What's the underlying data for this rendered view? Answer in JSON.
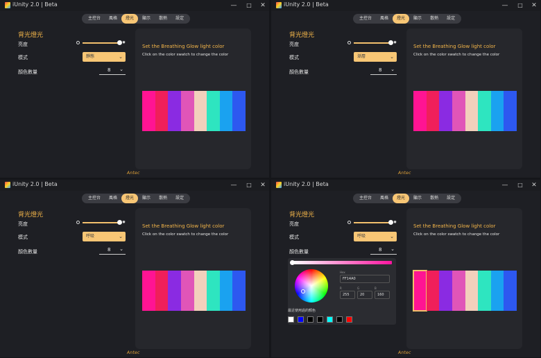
{
  "app": {
    "title": "iUnity 2.0 | Beta",
    "brand": "Antec"
  },
  "window_controls": {
    "minimize": "—",
    "maximize": "□",
    "close": "✕"
  },
  "tabs": [
    "主控台",
    "風格",
    "燈光",
    "顯示",
    "散熱",
    "設定"
  ],
  "active_tab_index": 2,
  "sidebar": {
    "heading": "背光燈光",
    "brightness_label": "亮度",
    "brightness_level": 1.0,
    "mode_label": "模式",
    "color_count_label": "顏色數量",
    "color_count_value": "8"
  },
  "panel": {
    "title": "Set the Breathing Glow light color",
    "subtitle": "Click on the color swatch to change the color"
  },
  "swatch_colors": [
    "#ff1493",
    "#f01f5a",
    "#8a2be2",
    "#e055b8",
    "#f2d0bc",
    "#2ee5c0",
    "#1aa2f0",
    "#2d58f0"
  ],
  "panes": [
    {
      "mode_value": "靜態",
      "selected_swatch": null
    },
    {
      "mode_value": "漸層",
      "selected_swatch": null
    },
    {
      "mode_value": "呼吸",
      "selected_swatch": null
    },
    {
      "mode_value": "呼吸",
      "selected_swatch": 0
    }
  ],
  "picker": {
    "hex_label": "Hex",
    "hex_value": "FF14A0",
    "r_label": "R",
    "g_label": "G",
    "b_label": "B",
    "r_value": "255",
    "g_value": "20",
    "b_value": "160",
    "recent_label": "最近使用過的顏色",
    "recent_colors": [
      "#ffffff",
      "#0000ff",
      "#000000",
      "#000000",
      "#00ffff",
      "#000000",
      "#ff0000"
    ]
  },
  "accent_color": "#f8c675"
}
